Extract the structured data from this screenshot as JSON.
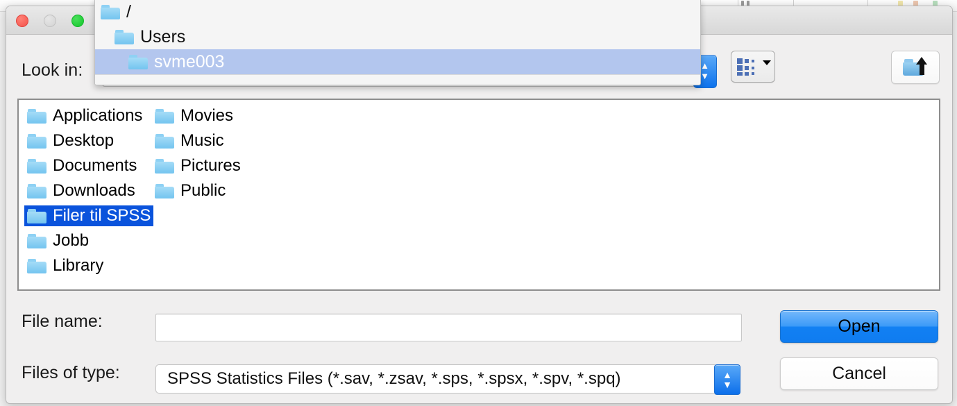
{
  "window": {
    "traffic_lights": [
      "close",
      "minimize",
      "maximize"
    ]
  },
  "toolbar": {
    "look_in_label": "Look in:",
    "look_in_value": "svme003",
    "view_mode_button_name": "grid-view",
    "up_one_level_button_name": "up-one-level"
  },
  "path_dropdown": {
    "open": true,
    "items": [
      {
        "label": "/",
        "indent": 0,
        "selected": false
      },
      {
        "label": "Users",
        "indent": 1,
        "selected": false
      },
      {
        "label": "svme003",
        "indent": 2,
        "selected": true
      }
    ]
  },
  "file_list": {
    "column_one": [
      {
        "label": "Applications",
        "selected": false
      },
      {
        "label": "Desktop",
        "selected": false
      },
      {
        "label": "Documents",
        "selected": false
      },
      {
        "label": "Downloads",
        "selected": false
      },
      {
        "label": "Filer til SPSS",
        "selected": true
      },
      {
        "label": "Jobb",
        "selected": false
      },
      {
        "label": "Library",
        "selected": false
      }
    ],
    "column_two": [
      {
        "label": "Movies",
        "selected": false
      },
      {
        "label": "Music",
        "selected": false
      },
      {
        "label": "Pictures",
        "selected": false
      },
      {
        "label": "Public",
        "selected": false
      }
    ]
  },
  "fields": {
    "file_name_label": "File name:",
    "file_name_value": "",
    "file_name_placeholder": "",
    "files_of_type_label": "Files of type:",
    "files_of_type_value": "SPSS Statistics Files (*.sav, *.zsav, *.sps, *.spsx, *.spv, *.spq)"
  },
  "buttons": {
    "open": "Open",
    "cancel": "Cancel"
  },
  "colors": {
    "selection_blue": "#0a53dc",
    "popup_selection": "#b3c6ee",
    "accent_blue": "#0d72ec",
    "folder_blue": "#73c4ef",
    "dialog_bg": "#f0efef"
  }
}
